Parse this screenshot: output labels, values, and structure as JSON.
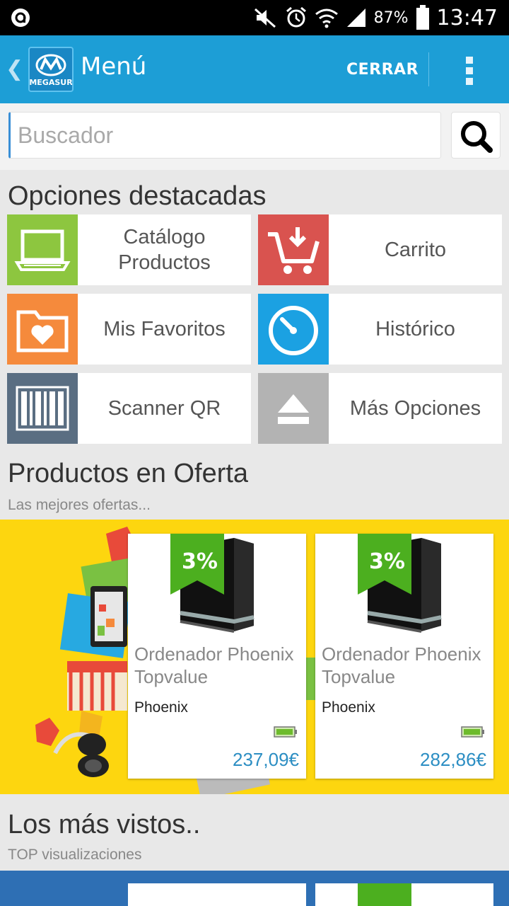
{
  "status_bar": {
    "battery_percent": "87%",
    "time": "13:47"
  },
  "action_bar": {
    "logo_text": "MEGASUR",
    "title": "Menú",
    "close_label": "CERRAR"
  },
  "search": {
    "placeholder": "Buscador"
  },
  "featured": {
    "heading": "Opciones destacadas",
    "tiles": [
      {
        "label_line1": "Catálogo",
        "label_line2": "Productos",
        "color": "#8dc63f",
        "icon": "laptop-icon"
      },
      {
        "label": "Carrito",
        "color": "#d9534f",
        "icon": "cart-icon"
      },
      {
        "label": "Mis Favoritos",
        "color": "#f58a3c",
        "icon": "folder-heart-icon"
      },
      {
        "label": "Histórico",
        "color": "#1ba1e2",
        "icon": "timer-icon"
      },
      {
        "label": "Scanner QR",
        "color": "#5a6e82",
        "icon": "barcode-icon"
      },
      {
        "label": "Más Opciones",
        "color": "#b3b3b3",
        "icon": "eject-icon"
      }
    ]
  },
  "offers": {
    "heading": "Productos en Oferta",
    "subheading": "Las mejores ofertas...",
    "products": [
      {
        "discount": "3%",
        "name_line1": "Ordenador Phoenix",
        "name_line2": "Topvalue",
        "brand": "Phoenix",
        "price": "237,09€"
      },
      {
        "discount": "3%",
        "name_line1": "Ordenador Phoenix",
        "name_line2": "Topvalue",
        "brand": "Phoenix",
        "price": "282,86€"
      }
    ]
  },
  "most_viewed": {
    "heading": "Los más vistos..",
    "subheading": "TOP visualizaciones"
  },
  "colors": {
    "action_bar": "#1d9ed6",
    "banner": "#fdd60f",
    "badge_green": "#4caf1f",
    "price_blue": "#2c8ec3"
  }
}
